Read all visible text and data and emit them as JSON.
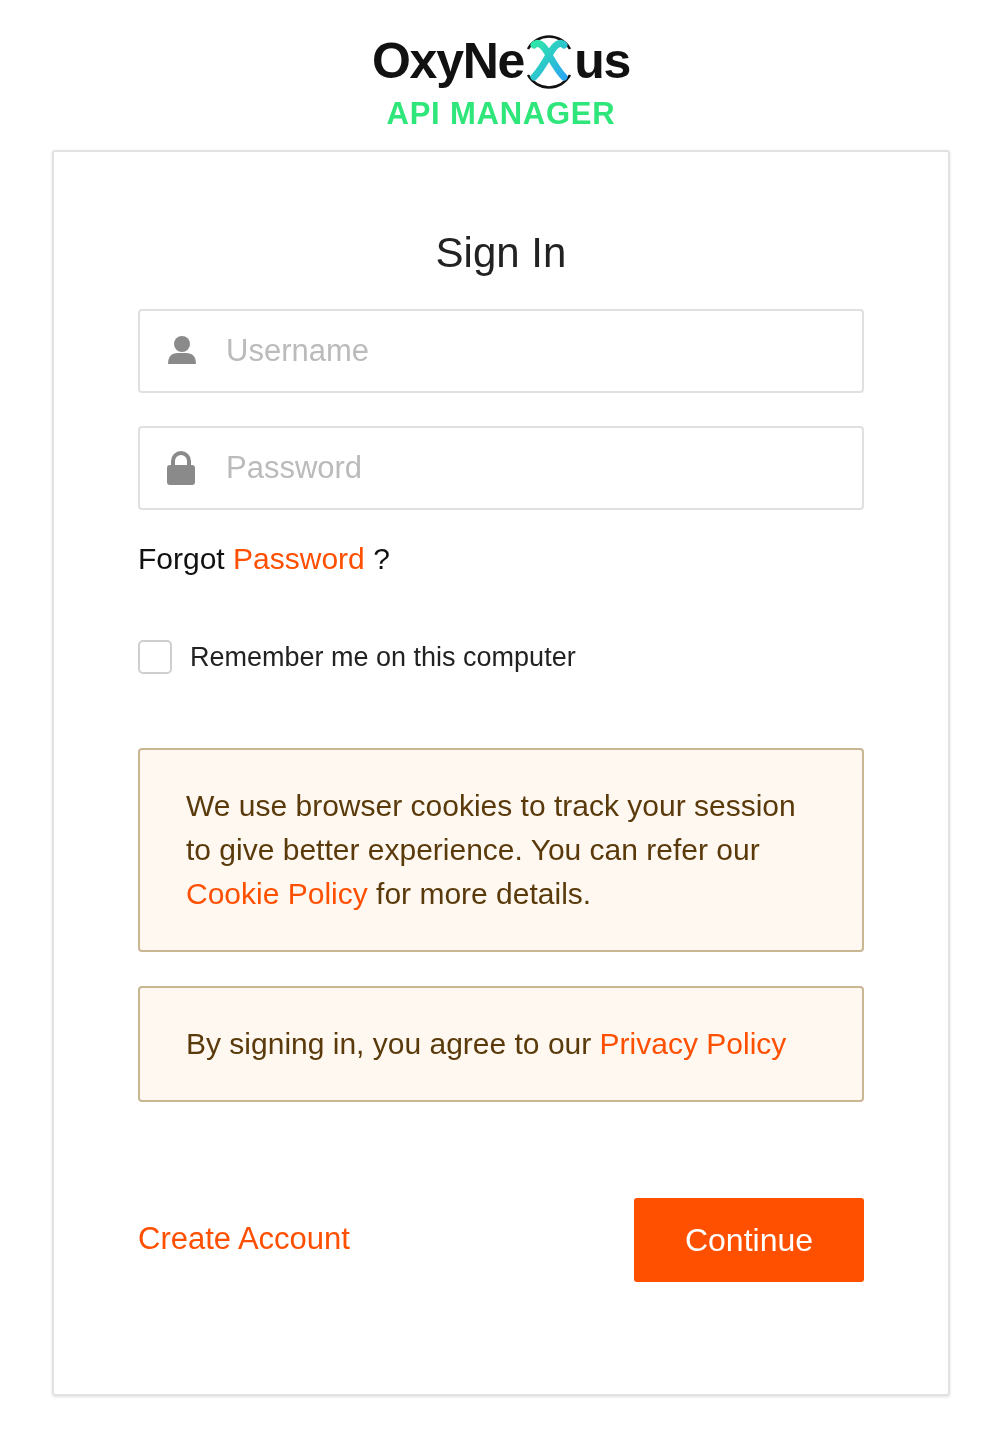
{
  "logo": {
    "before": "OxyNe",
    "after": "us",
    "subtitle": "API MANAGER"
  },
  "title": "Sign In",
  "fields": [
    {
      "kind": "user",
      "placeholder": "Username"
    },
    {
      "kind": "lock",
      "placeholder": "Password"
    }
  ],
  "forgot": {
    "before": "Forgot",
    "link": "Password",
    "after": "?"
  },
  "remember": {
    "label": "Remember me on this computer",
    "checked": false
  },
  "notices": [
    {
      "before": "We use browser cookies to track your session to give better experience. You can refer our",
      "link": "Cookie Policy",
      "after": "for more details."
    },
    {
      "before": "By signing in, you agree to our",
      "link": "Privacy Policy"
    }
  ],
  "create_account": "Create Account",
  "continue": "Continue"
}
